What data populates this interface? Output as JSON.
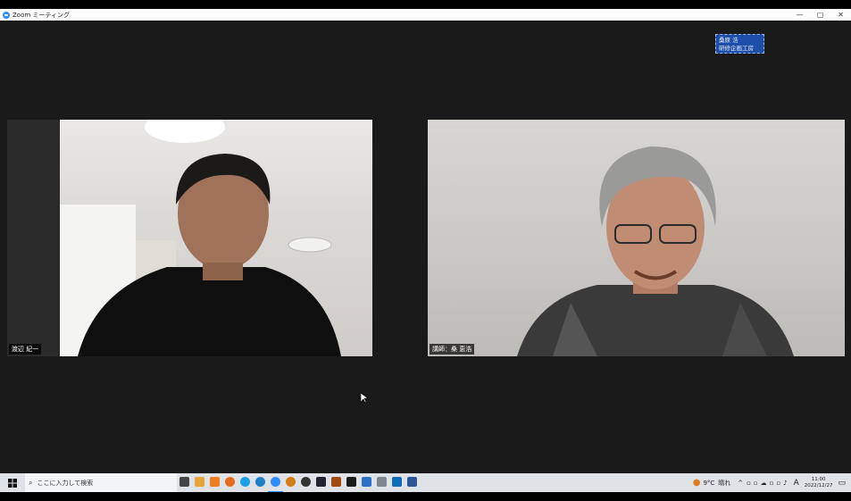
{
  "window": {
    "title": "Zoom ミーティング",
    "controls": [
      "—",
      "▢",
      "✕"
    ]
  },
  "overlay_tag": {
    "line1": "桑原 浩",
    "line2": "研修企画工房"
  },
  "participants": [
    {
      "name": "渡辺 紀一"
    },
    {
      "name": "講師：桑 恵浩"
    }
  ],
  "taskbar": {
    "search_placeholder": "ここに入力して検索",
    "apps": [
      {
        "name": "task-view-icon",
        "color": "#444"
      },
      {
        "name": "file-explorer-icon",
        "color": "#e8a33a"
      },
      {
        "name": "app-icon-1",
        "color": "#ef7d1f"
      },
      {
        "name": "firefox-icon",
        "color": "#e66b1a"
      },
      {
        "name": "skype-icon",
        "color": "#1aa1e8"
      },
      {
        "name": "edge-icon",
        "color": "#1f7fc9"
      },
      {
        "name": "zoom-icon",
        "color": "#2d8cff"
      },
      {
        "name": "app-icon-2",
        "color": "#d47b14"
      },
      {
        "name": "app-icon-3",
        "color": "#333333"
      },
      {
        "name": "app-icon-4",
        "color": "#223"
      },
      {
        "name": "app-icon-5",
        "color": "#a04a12"
      },
      {
        "name": "app-icon-6",
        "color": "#1b1b1b"
      },
      {
        "name": "app-icon-7",
        "color": "#2a73c9"
      },
      {
        "name": "camera-icon",
        "color": "#7d8590"
      },
      {
        "name": "outlook-icon",
        "color": "#0f6cbd"
      },
      {
        "name": "word-icon",
        "color": "#2b579a"
      }
    ],
    "weather": {
      "temp": "9°C",
      "condition": "晴れ"
    },
    "ime": "A",
    "clock": {
      "time": "11:00",
      "date": "2022/12/27"
    }
  }
}
